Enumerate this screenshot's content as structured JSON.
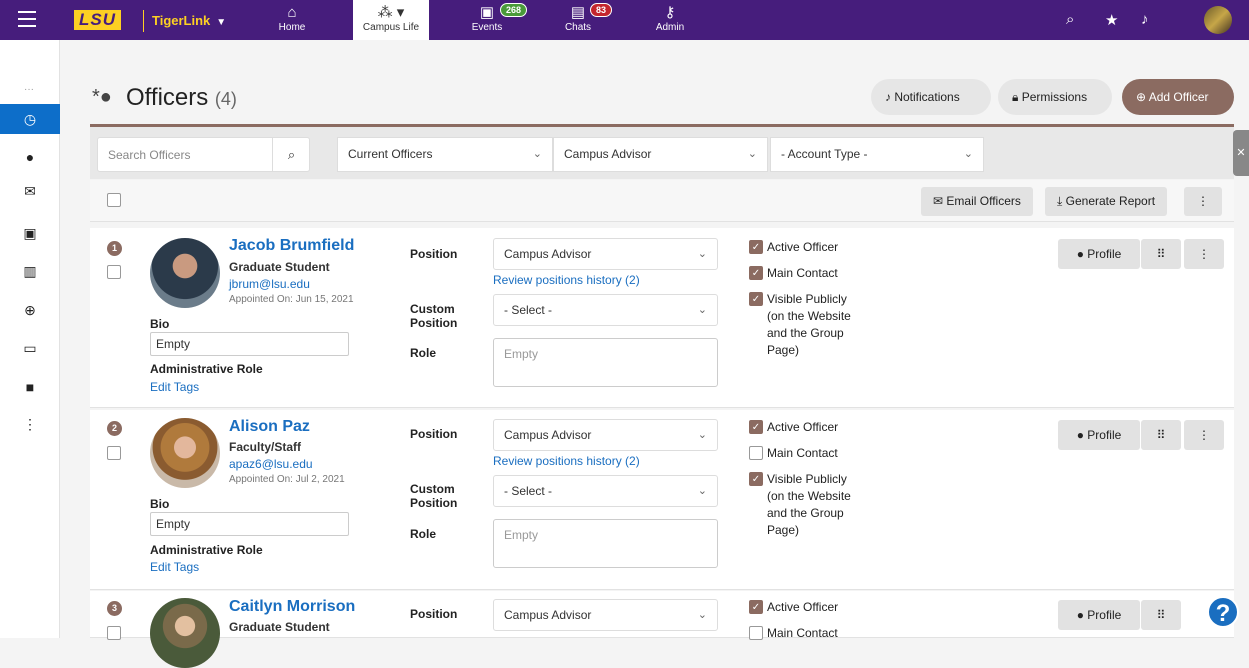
{
  "topnav": {
    "brand": "LSU",
    "app_name": "TigerLink",
    "tabs": [
      {
        "label": "Home",
        "icon": "home-icon"
      },
      {
        "label": "Campus Life",
        "icon": "people-icon"
      },
      {
        "label": "Events",
        "icon": "calendar-icon",
        "badge": "268"
      },
      {
        "label": "Chats",
        "icon": "chat-icon",
        "badge": "83"
      },
      {
        "label": "Admin",
        "icon": "key-icon"
      }
    ]
  },
  "page": {
    "title": "Officers",
    "count": "(4)",
    "notifications_label": "Notifications",
    "permissions_label": "Permissions",
    "add_officer_label": "Add Officer"
  },
  "filters": {
    "search_placeholder": "Search Officers",
    "status": "Current Officers",
    "position": "Campus Advisor",
    "account_type": "- Account Type -"
  },
  "toolbar": {
    "email_label": "Email Officers",
    "report_label": "Generate Report"
  },
  "labels": {
    "position": "Position",
    "custom": "Custom",
    "position2": "Position",
    "role": "Role",
    "bio": "Bio",
    "admin_role": "Administrative Role",
    "edit_tags": "Edit Tags",
    "active": "Active Officer",
    "main": "Main Contact",
    "visible1": "Visible Publicly",
    "visible2": "(on the Website",
    "visible3": "and the Group",
    "visible4": "Page)",
    "profile": "Profile",
    "select": "- Select -",
    "empty": "Empty"
  },
  "officers": [
    {
      "num": "1",
      "name": "Jacob Brumfield",
      "type": "Graduate Student",
      "email": "jbrum@lsu.edu",
      "appointed": "Appointed On: Jun 15, 2021",
      "position": "Campus Advisor",
      "history": "Review positions history (2)",
      "bio": "Empty",
      "active": true,
      "main": true,
      "visible": true
    },
    {
      "num": "2",
      "name": "Alison Paz",
      "type": "Faculty/Staff",
      "email": "apaz6@lsu.edu",
      "appointed": "Appointed On: Jul 2, 2021",
      "position": "Campus Advisor",
      "history": "Review positions history (2)",
      "bio": "Empty",
      "active": true,
      "main": false,
      "visible": true
    },
    {
      "num": "3",
      "name": "Caitlyn Morrison",
      "type": "Graduate Student",
      "position": "Campus Advisor",
      "active": true,
      "main": false
    }
  ],
  "colors": {
    "brand_purple": "#461d7c",
    "accent_gold": "#fdd023",
    "brown": "#8b6b61",
    "link": "#1a6ec0"
  }
}
